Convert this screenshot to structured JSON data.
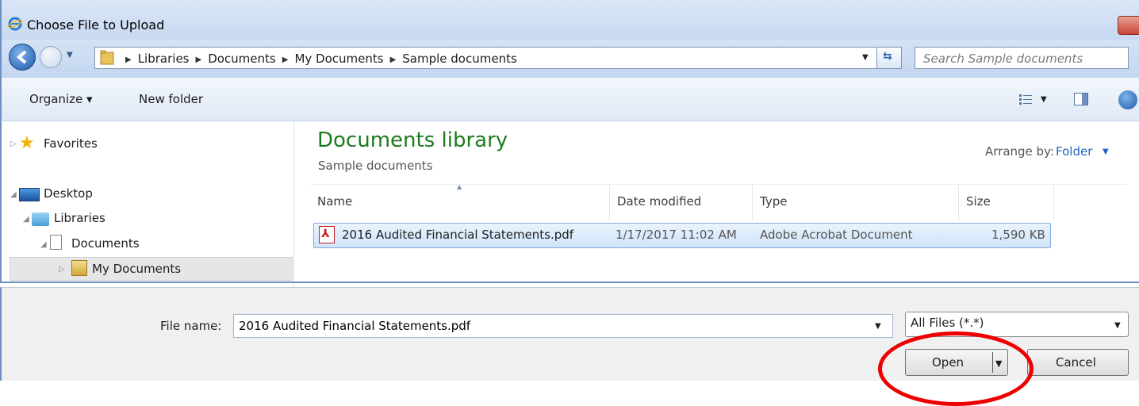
{
  "window": {
    "title": "Choose File to Upload"
  },
  "address": {
    "breadcrumb": [
      "Libraries",
      "Documents",
      "My Documents",
      "Sample documents"
    ],
    "search_placeholder": "Search Sample documents"
  },
  "toolbar": {
    "organize_label": "Organize ▾",
    "new_folder_label": "New folder"
  },
  "nav": {
    "favorites": "Favorites",
    "desktop": "Desktop",
    "libraries": "Libraries",
    "documents": "Documents",
    "my_documents": "My Documents"
  },
  "content": {
    "library_title": "Documents library",
    "library_subtitle": "Sample documents",
    "arrange_label": "Arrange by:",
    "arrange_value": "Folder",
    "columns": [
      "Name",
      "Date modified",
      "Type",
      "Size"
    ],
    "files": [
      {
        "name": "2016 Audited Financial Statements.pdf",
        "date": "1/17/2017 11:02 AM",
        "type": "Adobe Acrobat Document",
        "size": "1,590 KB"
      }
    ]
  },
  "footer": {
    "file_name_label": "File name:",
    "file_name_value": "2016 Audited Financial Statements.pdf",
    "filter_value": "All Files (*.*)",
    "open_label": "Open",
    "cancel_label": "Cancel"
  },
  "colors": {
    "library_title": "#1e7b1e",
    "link": "#1f64c0",
    "selection": "#cfe4fa",
    "highlight": "#e00000"
  }
}
